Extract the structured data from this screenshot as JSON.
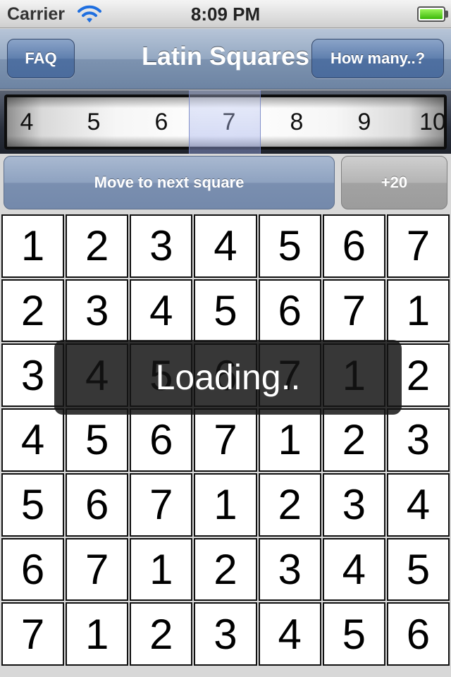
{
  "status_bar": {
    "carrier": "Carrier",
    "time": "8:09 PM"
  },
  "nav": {
    "title": "Latin Squares",
    "left_button": "FAQ",
    "right_button": "How many..?"
  },
  "picker": {
    "items": [
      "4",
      "5",
      "6",
      "7",
      "8",
      "9",
      "10"
    ],
    "selected": "7"
  },
  "actions": {
    "next_label": "Move to next square",
    "plus_label": "+20"
  },
  "grid": {
    "rows": [
      [
        "1",
        "2",
        "3",
        "4",
        "5",
        "6",
        "7"
      ],
      [
        "2",
        "3",
        "4",
        "5",
        "6",
        "7",
        "1"
      ],
      [
        "3",
        "4",
        "5",
        "6",
        "7",
        "1",
        "2"
      ],
      [
        "4",
        "5",
        "6",
        "7",
        "1",
        "2",
        "3"
      ],
      [
        "5",
        "6",
        "7",
        "1",
        "2",
        "3",
        "4"
      ],
      [
        "6",
        "7",
        "1",
        "2",
        "3",
        "4",
        "5"
      ],
      [
        "7",
        "1",
        "2",
        "3",
        "4",
        "5",
        "6"
      ]
    ]
  },
  "overlay": {
    "text": "Loading.."
  },
  "colors": {
    "nav_tint": "#6d84a3",
    "button_blue": "#4f70a1",
    "battery_green": "#3cb80a"
  }
}
